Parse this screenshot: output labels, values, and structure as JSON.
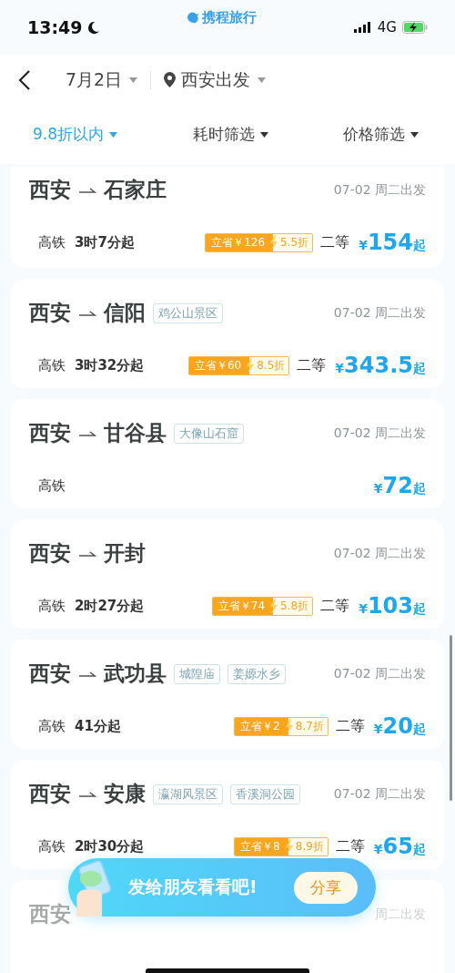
{
  "status_bar": {
    "time": "13:49",
    "logo": "携程旅行",
    "network": "4G"
  },
  "nav": {
    "date": "7月2日",
    "departure": "西安出发"
  },
  "filters": [
    {
      "label": "9.8折以内",
      "selected": true
    },
    {
      "label": "耗时筛选",
      "selected": false
    },
    {
      "label": "价格筛选",
      "selected": false
    }
  ],
  "routes": [
    {
      "from": "西安",
      "to": "石家庄",
      "date": "07-02 周二出发",
      "train_type": "高铁",
      "duration": "3时7分起",
      "savings": "立省￥126",
      "discount": "5.5折",
      "seat_class": "二等",
      "currency": "¥",
      "price": "154",
      "unit": "起"
    },
    {
      "from": "西安",
      "to": "信阳",
      "tags": [
        "鸡公山景区"
      ],
      "date": "07-02 周二出发",
      "train_type": "高铁",
      "duration": "3时32分起",
      "savings": "立省￥60",
      "discount": "8.5折",
      "seat_class": "二等",
      "currency": "¥",
      "price": "343.5",
      "unit": "起"
    },
    {
      "from": "西安",
      "to": "甘谷县",
      "tags": [
        "大像山石窟"
      ],
      "date": "07-02 周二出发",
      "train_type": "高铁",
      "currency": "¥",
      "price": "72",
      "unit": "起"
    },
    {
      "from": "西安",
      "to": "开封",
      "date": "07-02 周二出发",
      "train_type": "高铁",
      "duration": "2时27分起",
      "savings": "立省￥74",
      "discount": "5.8折",
      "seat_class": "二等",
      "currency": "¥",
      "price": "103",
      "unit": "起"
    },
    {
      "from": "西安",
      "to": "武功县",
      "tags": [
        "城隍庙",
        "姜嫄水乡"
      ],
      "date": "07-02 周二出发",
      "train_type": "高铁",
      "duration": "41分起",
      "savings": "立省￥2",
      "discount": "8.7折",
      "seat_class": "二等",
      "currency": "¥",
      "price": "20",
      "unit": "起"
    },
    {
      "from": "西安",
      "to": "安康",
      "tags": [
        "瀛湖风景区",
        "香溪洞公园"
      ],
      "date": "07-02 周二出发",
      "train_type": "高铁",
      "duration": "2时30分起",
      "savings": "立省￥8",
      "discount": "8.9折",
      "seat_class": "二等",
      "currency": "¥",
      "price": "65",
      "unit": "起"
    },
    {
      "from": "西安",
      "date": "周二出发"
    }
  ],
  "share_banner": {
    "text": "发给朋友看看吧!",
    "button": "分享"
  }
}
